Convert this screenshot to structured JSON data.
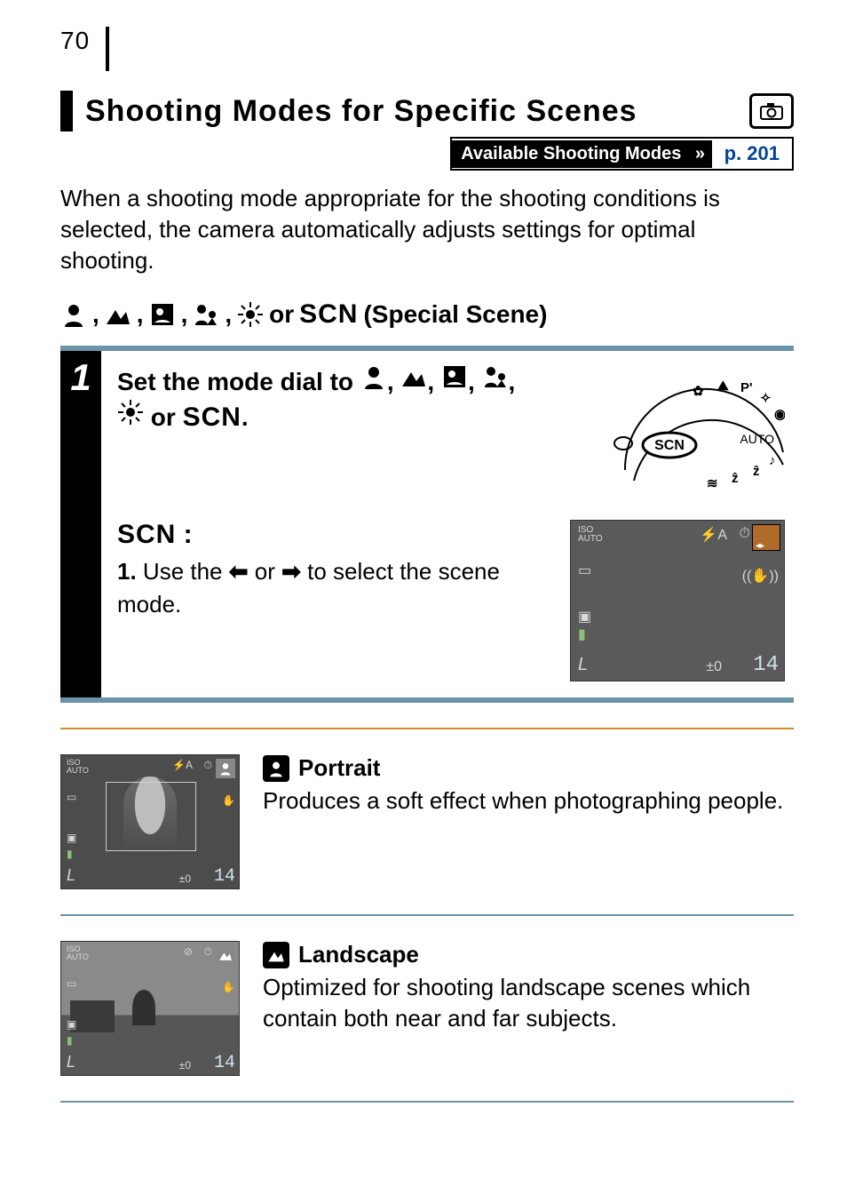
{
  "page_number": "70",
  "title": "Shooting Modes for Specific Scenes",
  "available_modes_label": "Available Shooting Modes",
  "available_modes_ref": "p. 201",
  "intro": "When a shooting mode appropriate for the shooting conditions is selected, the camera automatically adjusts settings for optimal shooting.",
  "modes_heading_icons": [
    "portrait",
    "landscape",
    "night-snapshot",
    "kids-pets",
    "indoor"
  ],
  "modes_heading_tail_or": " or ",
  "modes_heading_scn": "SCN",
  "modes_heading_tail": " (Special Scene)",
  "step": {
    "number": "1",
    "title_pre": "Set the mode dial to ",
    "title_icons": [
      "portrait",
      "landscape",
      "night-snapshot",
      "kids-pets",
      "indoor"
    ],
    "title_or": " or ",
    "title_scn": "SCN",
    "title_end": ".",
    "scn_label": "SCN",
    "substep_num": "1.",
    "substep_text_pre": " Use the ",
    "substep_text_mid": " or ",
    "substep_text_post": " to select the scene mode.",
    "lcd": {
      "iso": "ISO\nAUTO",
      "L": "L",
      "ev": "±0",
      "shots": "14"
    }
  },
  "descriptions": [
    {
      "icon": "portrait",
      "name": "Portrait",
      "body": "Produces a soft effect when photographing people.",
      "thumb": {
        "iso": "ISO\nAUTO",
        "L": "L",
        "ev": "±0",
        "shots": "14"
      }
    },
    {
      "icon": "landscape",
      "name": "Landscape",
      "body": "Optimized for shooting landscape scenes which contain both near and far subjects.",
      "thumb": {
        "iso": "ISO\nAUTO",
        "L": "L",
        "ev": "±0",
        "shots": "14"
      }
    }
  ]
}
